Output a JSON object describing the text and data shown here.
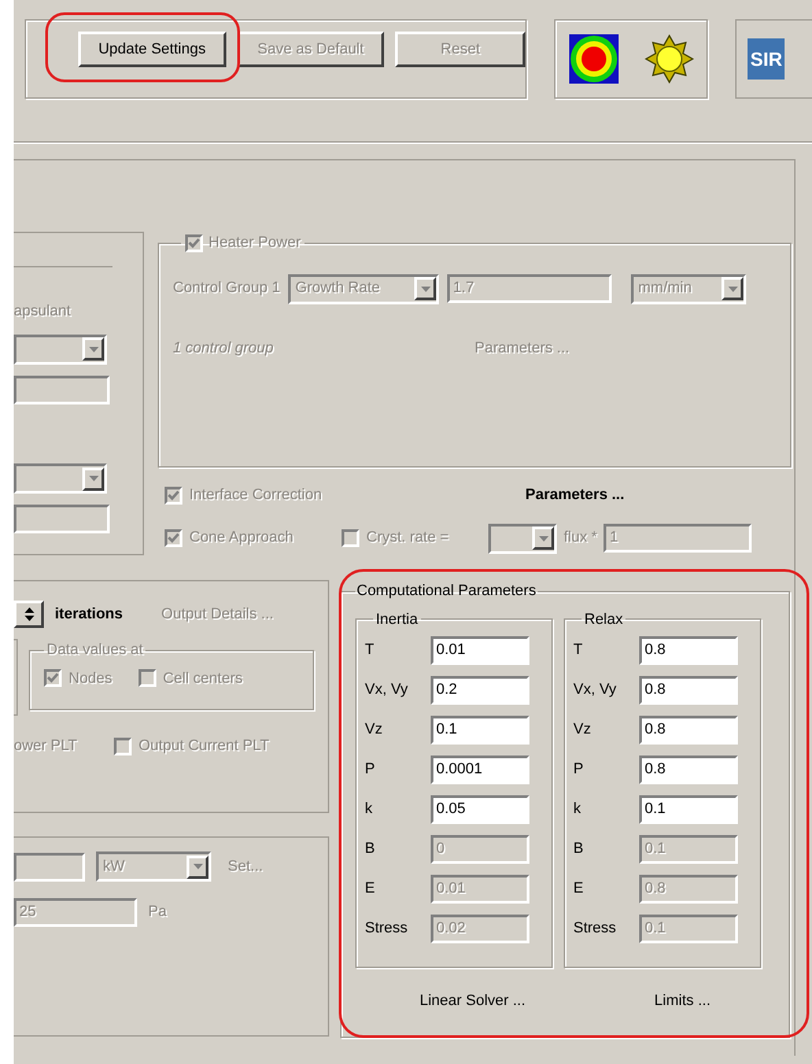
{
  "toolbar": {
    "buttons": [
      {
        "label": "Update Settings",
        "disabled": false
      },
      {
        "label": "Save as Default",
        "disabled": true
      },
      {
        "label": "Reset",
        "disabled": true
      }
    ],
    "logo_text": "SIR"
  },
  "left_panel": {
    "label": "apsulant"
  },
  "heater": {
    "checked": true,
    "disabled": true,
    "label": "Heater Power",
    "control_group_label": "Control Group 1",
    "mode": "Growth Rate",
    "value": "1.7",
    "unit": "mm/min",
    "note": "1 control group",
    "parameters_link": "Parameters ..."
  },
  "interface_correction": {
    "checked": true,
    "disabled": true,
    "label": "Interface Correction",
    "parameters_button": "Parameters ..."
  },
  "cone_row": {
    "cone": {
      "checked": true,
      "disabled": true,
      "label": "Cone Approach"
    },
    "cryst": {
      "checked": false,
      "disabled": true,
      "label": "Cryst. rate ="
    },
    "flux_label": "flux *",
    "flux_value": "1"
  },
  "output": {
    "iterations_label": "iterations",
    "output_details": "Output Details ...",
    "data_values_title": "Data values at",
    "data_values": [
      {
        "label": "Nodes",
        "checked": true
      },
      {
        "label": "Cell centers",
        "checked": false
      }
    ],
    "power_plt_label": "ower PLT",
    "current_plt": {
      "label": "Output Current PLT",
      "checked": false
    }
  },
  "power": {
    "unit": "kW",
    "set_link": "Set...",
    "pressure_value": "25",
    "pressure_unit": "Pa"
  },
  "computational": {
    "title": "Computational Parameters",
    "groups": [
      {
        "title": "Inertia",
        "rows": [
          {
            "label": "T",
            "value": "0.01",
            "disabled": false
          },
          {
            "label": "Vx, Vy",
            "value": "0.2",
            "disabled": false
          },
          {
            "label": "Vz",
            "value": "0.1",
            "disabled": false
          },
          {
            "label": "P",
            "value": "0.0001",
            "disabled": false
          },
          {
            "label": "k",
            "value": "0.05",
            "disabled": false
          },
          {
            "label": "B",
            "value": "0",
            "disabled": true
          },
          {
            "label": "E",
            "value": "0.01",
            "disabled": true
          },
          {
            "label": "Stress",
            "value": "0.02",
            "disabled": true
          }
        ]
      },
      {
        "title": "Relax",
        "rows": [
          {
            "label": "T",
            "value": "0.8",
            "disabled": false
          },
          {
            "label": "Vx, Vy",
            "value": "0.8",
            "disabled": false
          },
          {
            "label": "Vz",
            "value": "0.8",
            "disabled": false
          },
          {
            "label": "P",
            "value": "0.8",
            "disabled": false
          },
          {
            "label": "k",
            "value": "0.1",
            "disabled": false
          },
          {
            "label": "B",
            "value": "0.1",
            "disabled": true
          },
          {
            "label": "E",
            "value": "0.8",
            "disabled": true
          },
          {
            "label": "Stress",
            "value": "0.1",
            "disabled": true
          }
        ]
      }
    ],
    "buttons": [
      "Linear Solver ...",
      "Limits ..."
    ]
  }
}
